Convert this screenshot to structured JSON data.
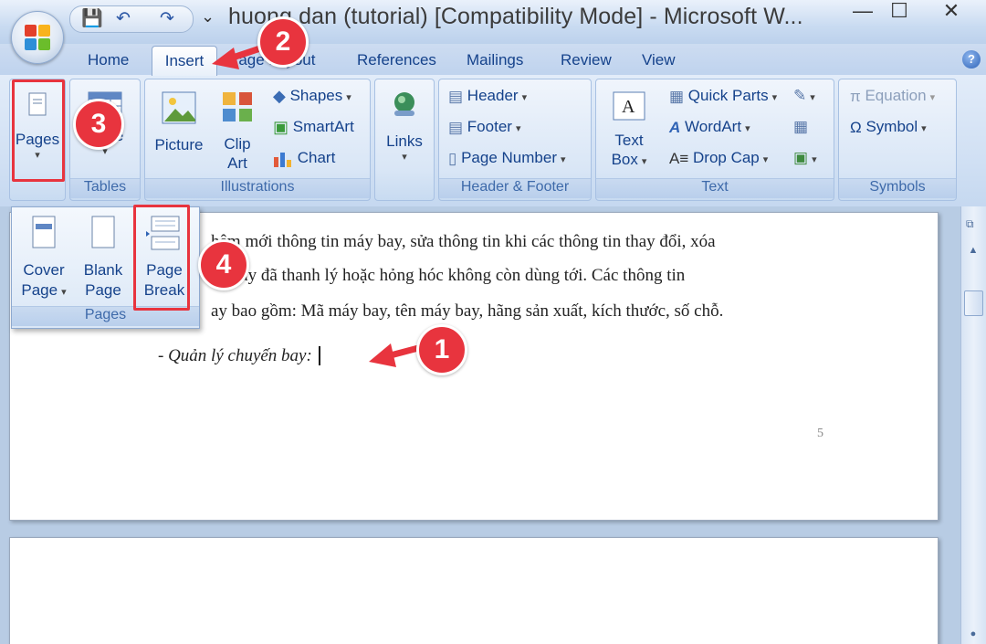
{
  "title": "huong dan (tutorial) [Compatibility Mode] - Microsoft W...",
  "window": {
    "minimize": "—",
    "maximize": "☐",
    "close": "✕"
  },
  "qat": {
    "save": "💾",
    "undo": "↶",
    "redo": "↷",
    "more": "⌄"
  },
  "tabs": [
    "Home",
    "Insert",
    "Page Layout",
    "References",
    "Mailings",
    "Review",
    "View"
  ],
  "help": "?",
  "ribbon": {
    "pages": {
      "label": "Pages"
    },
    "tables": {
      "button": "Table",
      "label": "Tables"
    },
    "illustrations": {
      "picture": "Picture",
      "clip1": "Clip",
      "clip2": "Art",
      "shapes": "Shapes",
      "smartart": "SmartArt",
      "chart": "Chart",
      "label": "Illustrations"
    },
    "links": {
      "button": "Links"
    },
    "header_footer": {
      "header": "Header",
      "footer": "Footer",
      "page_number": "Page Number",
      "label": "Header & Footer"
    },
    "text": {
      "textbox1": "Text",
      "textbox2": "Box",
      "quick_parts": "Quick Parts",
      "wordart": "WordArt",
      "drop_cap": "Drop Cap",
      "label": "Text"
    },
    "symbols": {
      "equation": "Equation",
      "symbol": "Symbol",
      "label": "Symbols"
    }
  },
  "pages_menu": {
    "cover1": "Cover",
    "cover2": "Page",
    "blank1": "Blank",
    "blank2": "Page",
    "break1": "Page",
    "break2": "Break",
    "label": "Pages"
  },
  "document": {
    "line1": "hêm mới thông tin máy bay, sửa thông tin khi các thông tin thay đổi, xóa",
    "line2": "áy bay đã thanh lý hoặc hỏng hóc không còn dùng tới. Các thông tin",
    "line3": "ay bao gồm: Mã máy bay, tên máy bay, hãng sản xuất, kích thước, số chỗ.",
    "line4": "- Quản lý chuyến bay: ",
    "page_number": "5"
  },
  "annotations": [
    "1",
    "2",
    "3",
    "4"
  ],
  "colors": {
    "accent": "#e8343e",
    "ribbon_text": "#15428b"
  }
}
